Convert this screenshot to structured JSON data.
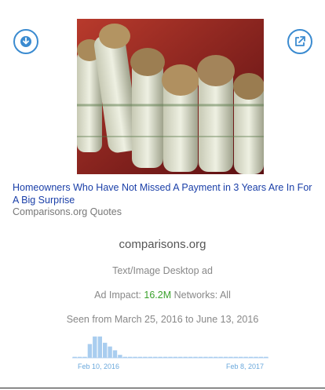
{
  "ad": {
    "title": "Homeowners Who Have Not Missed A Payment in 3 Years Are In For A Big Surprise",
    "source": "Comparisons.org Quotes",
    "domain": "comparisons.org",
    "ad_type": "Text/Image Desktop ad",
    "impact_label": "Ad Impact:",
    "impact_value": "16.2M",
    "networks_label": "Networks: All",
    "seen": "Seen from March 25, 2016 to June 13, 2016"
  },
  "icons": {
    "download": "download-circle-icon",
    "open": "external-link-icon"
  },
  "colors": {
    "accent": "#3b8bd0",
    "title": "#1a3fa8",
    "impact_green": "#3aa12b",
    "histogram_bar": "#a9cdef",
    "histogram_baseline": "#cfe2f6"
  },
  "histogram": {
    "start_label": "Feb 10, 2016",
    "end_label": "Feb 8, 2017",
    "levels": [
      0.04,
      0.04,
      0.04,
      0.55,
      0.85,
      0.85,
      0.6,
      0.45,
      0.3,
      0.12,
      0.04,
      0.04,
      0.04,
      0.04,
      0.04,
      0.04,
      0.04,
      0.04,
      0.04,
      0.04,
      0.04,
      0.04,
      0.04,
      0.04,
      0.04,
      0.04,
      0.04,
      0.04,
      0.04,
      0.04,
      0.04,
      0.04,
      0.04,
      0.04,
      0.04,
      0.04,
      0.04,
      0.04,
      0.04
    ]
  }
}
